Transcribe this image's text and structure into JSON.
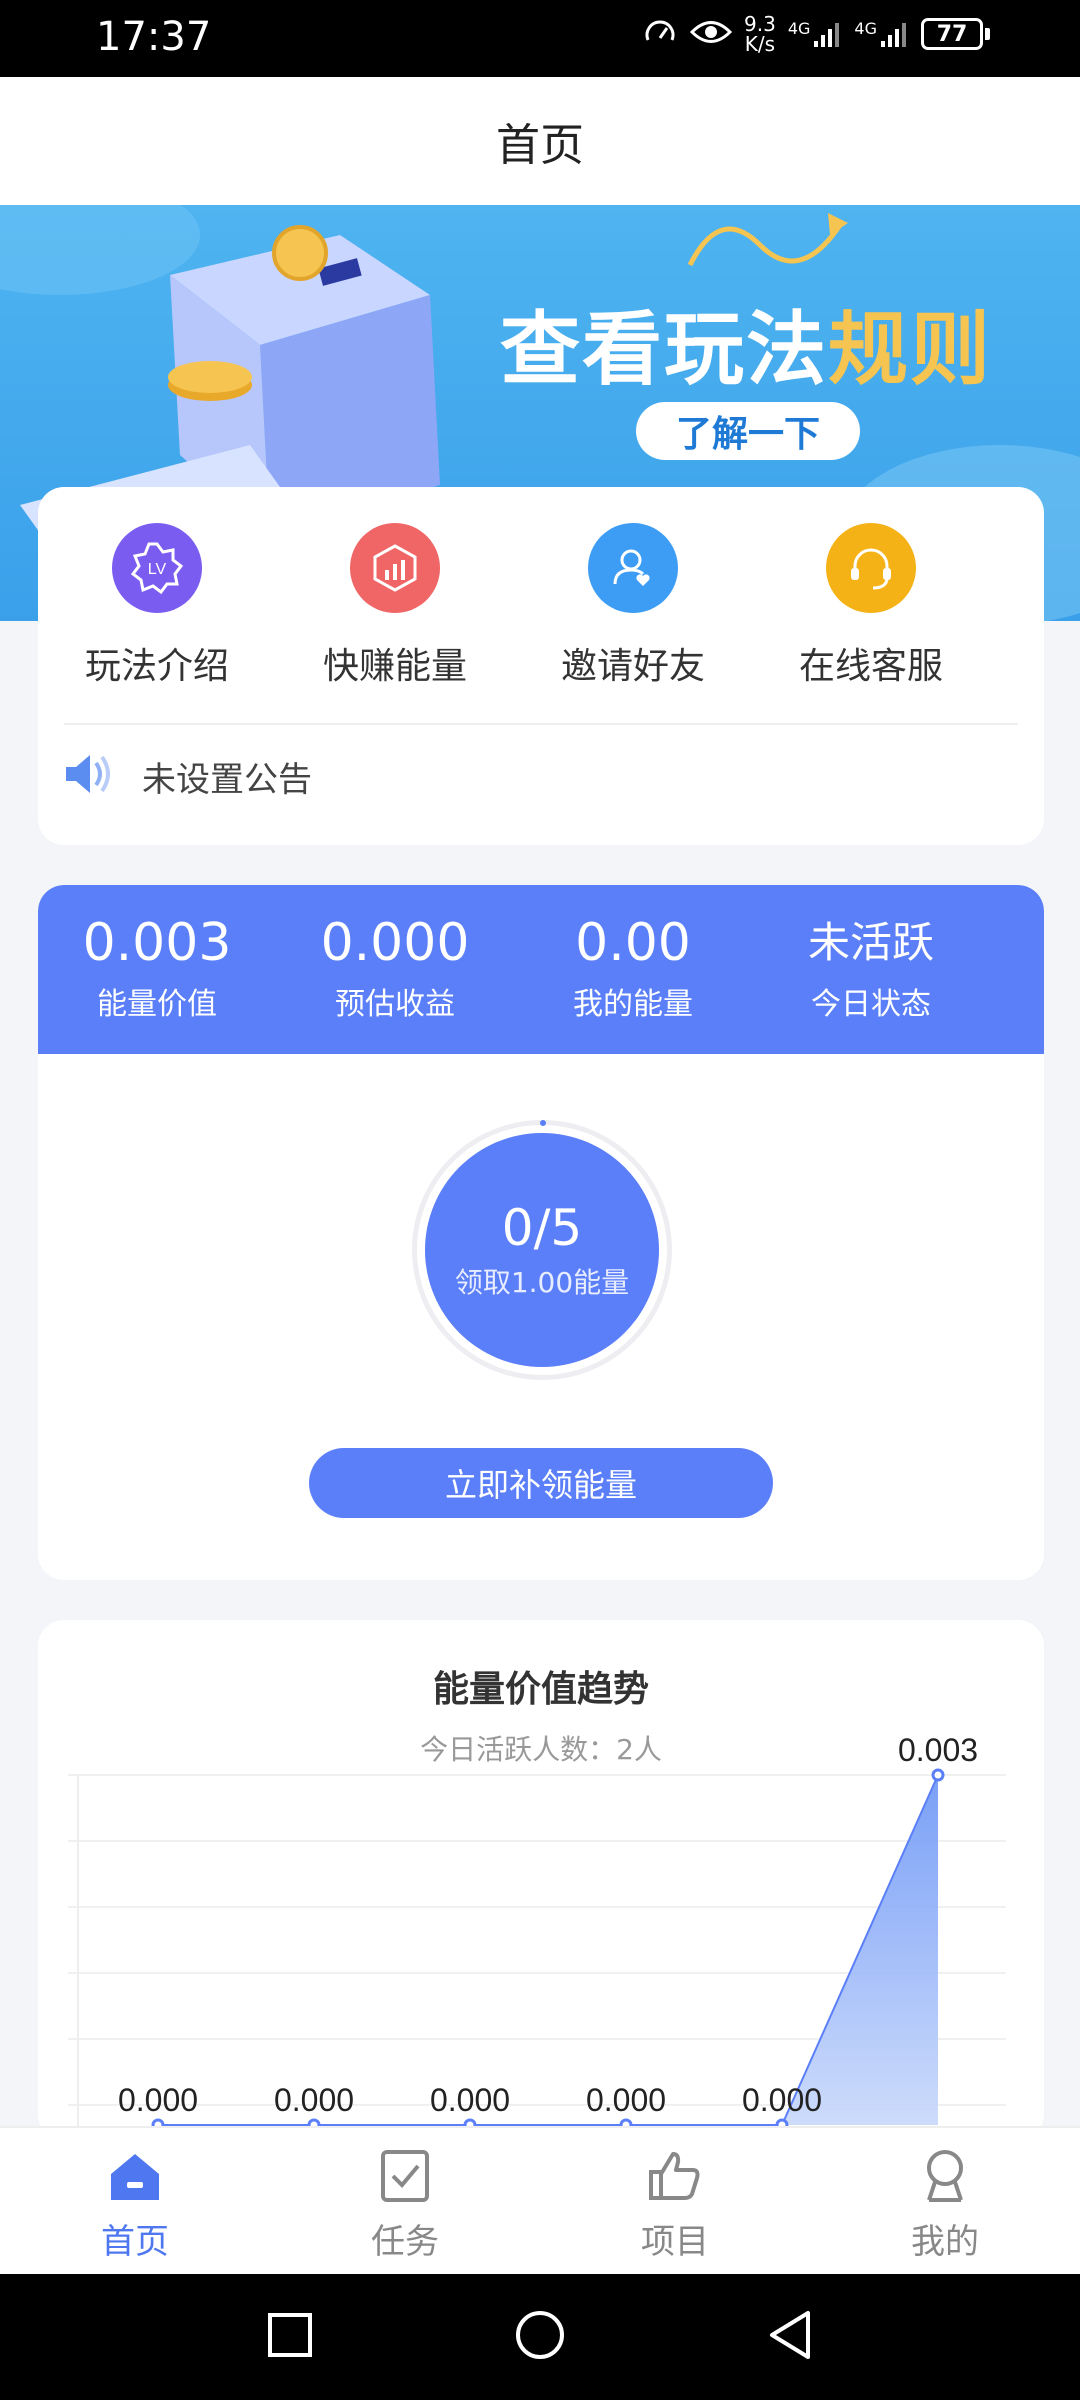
{
  "status_bar": {
    "time": "17:37",
    "net_speed_value": "9.3",
    "net_speed_unit": "K/s",
    "signal1": "4G",
    "signal2": "4G",
    "battery": "77"
  },
  "header": {
    "title": "首页"
  },
  "banner": {
    "title_main": "查看玩法",
    "title_highlight": "规则",
    "button_label": "了解一下"
  },
  "menu": {
    "items": [
      {
        "label": "玩法介绍",
        "icon": "lv-badge-icon",
        "color": "#7b5cf0"
      },
      {
        "label": "快赚能量",
        "icon": "chart-hexagon-icon",
        "color": "#f06565"
      },
      {
        "label": "邀请好友",
        "icon": "invite-user-icon",
        "color": "#3d9df5"
      },
      {
        "label": "在线客服",
        "icon": "headset-icon",
        "color": "#f5b217"
      }
    ]
  },
  "notice": {
    "text": "未设置公告"
  },
  "stats": [
    {
      "value": "0.003",
      "label": "能量价值"
    },
    {
      "value": "0.000",
      "label": "预估收益"
    },
    {
      "value": "0.00",
      "label": "我的能量"
    },
    {
      "value": "未活跃",
      "label": "今日状态"
    }
  ],
  "claim": {
    "progress": "0/5",
    "reward_text": "领取1.00能量",
    "button_label": "立即补领能量"
  },
  "trend": {
    "title": "能量价值趋势",
    "subtitle": "今日活跃人数：2人"
  },
  "chart_data": {
    "type": "area",
    "x": [
      1,
      2,
      3,
      4,
      5,
      6
    ],
    "values": [
      0.0,
      0.0,
      0.0,
      0.0,
      0.0,
      0.003
    ],
    "data_labels": [
      "0.000",
      "0.000",
      "0.000",
      "0.000",
      "0.000",
      "0.003"
    ],
    "ylim": [
      0,
      0.003
    ],
    "grid": true
  },
  "tabbar": {
    "items": [
      {
        "label": "首页",
        "icon": "home-icon",
        "active": true
      },
      {
        "label": "任务",
        "icon": "task-check-icon",
        "active": false
      },
      {
        "label": "项目",
        "icon": "thumbs-up-icon",
        "active": false
      },
      {
        "label": "我的",
        "icon": "user-icon",
        "active": false
      }
    ]
  },
  "colors": {
    "accent": "#5b7ff8",
    "tab_active": "#4f78f0",
    "banner_blue": "#3aa0ea",
    "highlight_yellow": "#f6c451"
  }
}
